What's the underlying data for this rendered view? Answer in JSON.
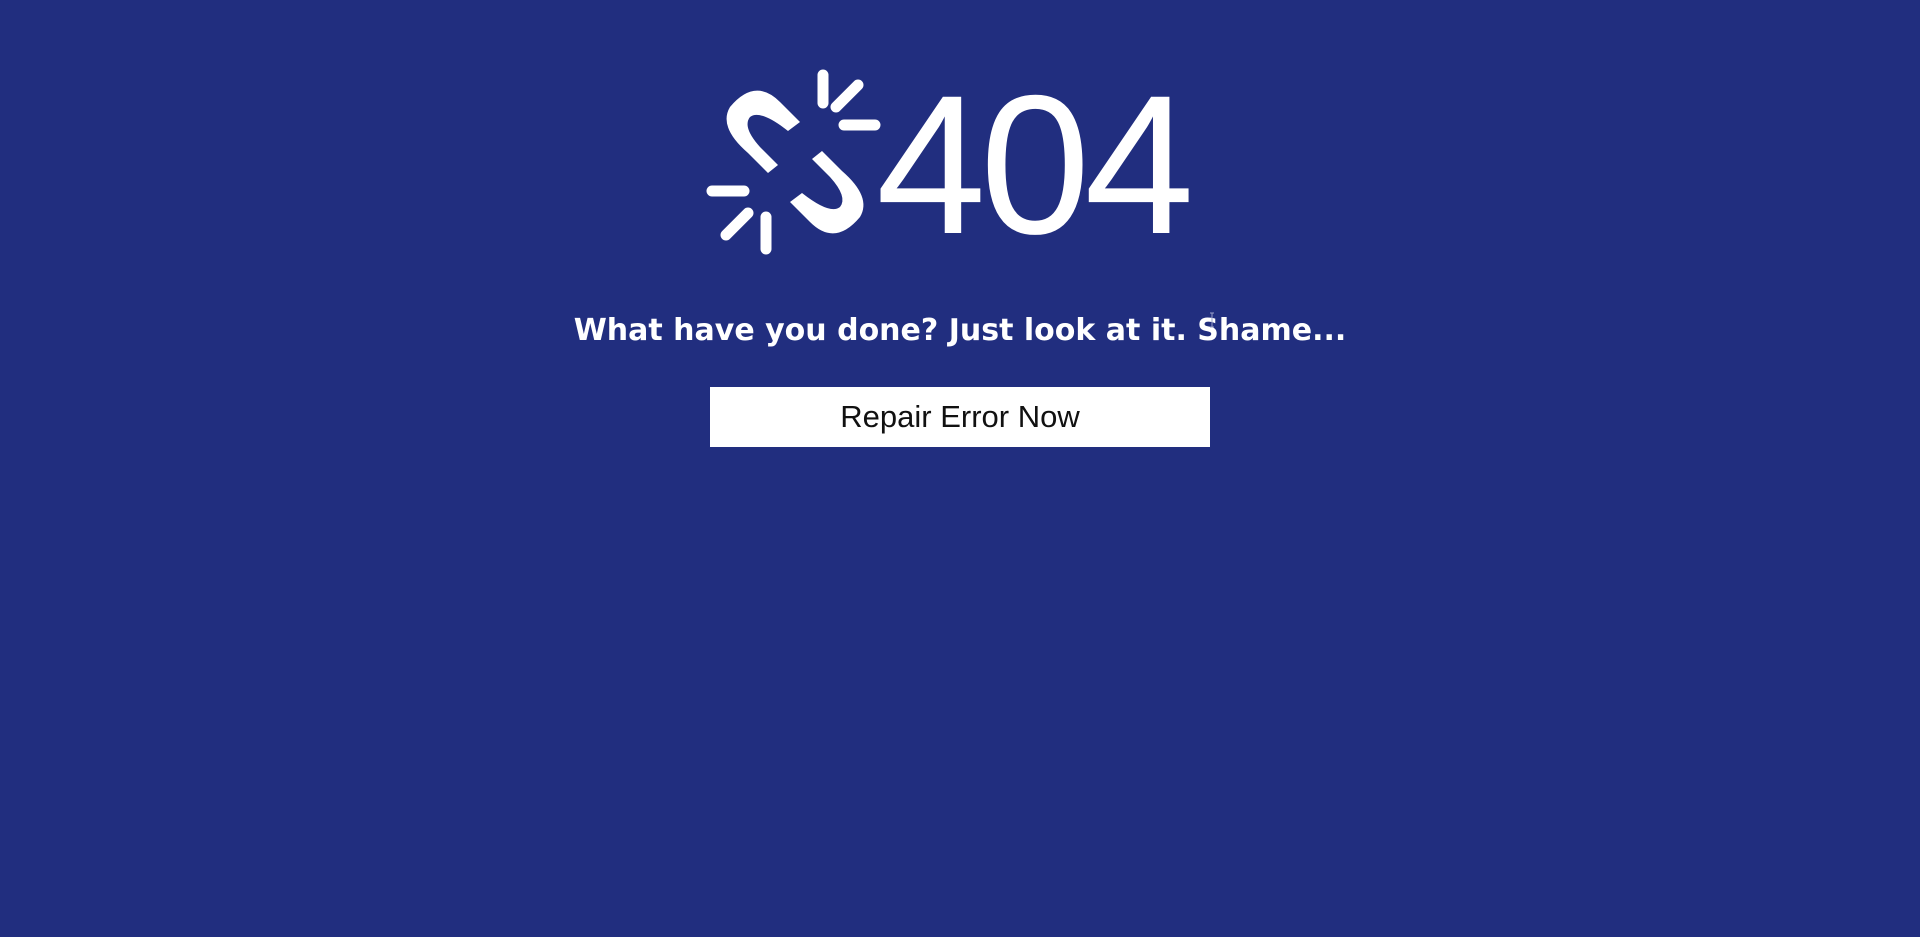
{
  "page": {
    "background_color": "#212e7f",
    "foreground_color": "#ffffff"
  },
  "hero": {
    "icon": "broken-link-icon",
    "error_code": "404"
  },
  "message": {
    "text": "What have you done? Just look at it. Shame..."
  },
  "action": {
    "label": "Repair Error Now",
    "button_color": "#ffffff",
    "text_color": "#111111"
  },
  "cursor": {
    "icon": "text-cursor-icon"
  }
}
